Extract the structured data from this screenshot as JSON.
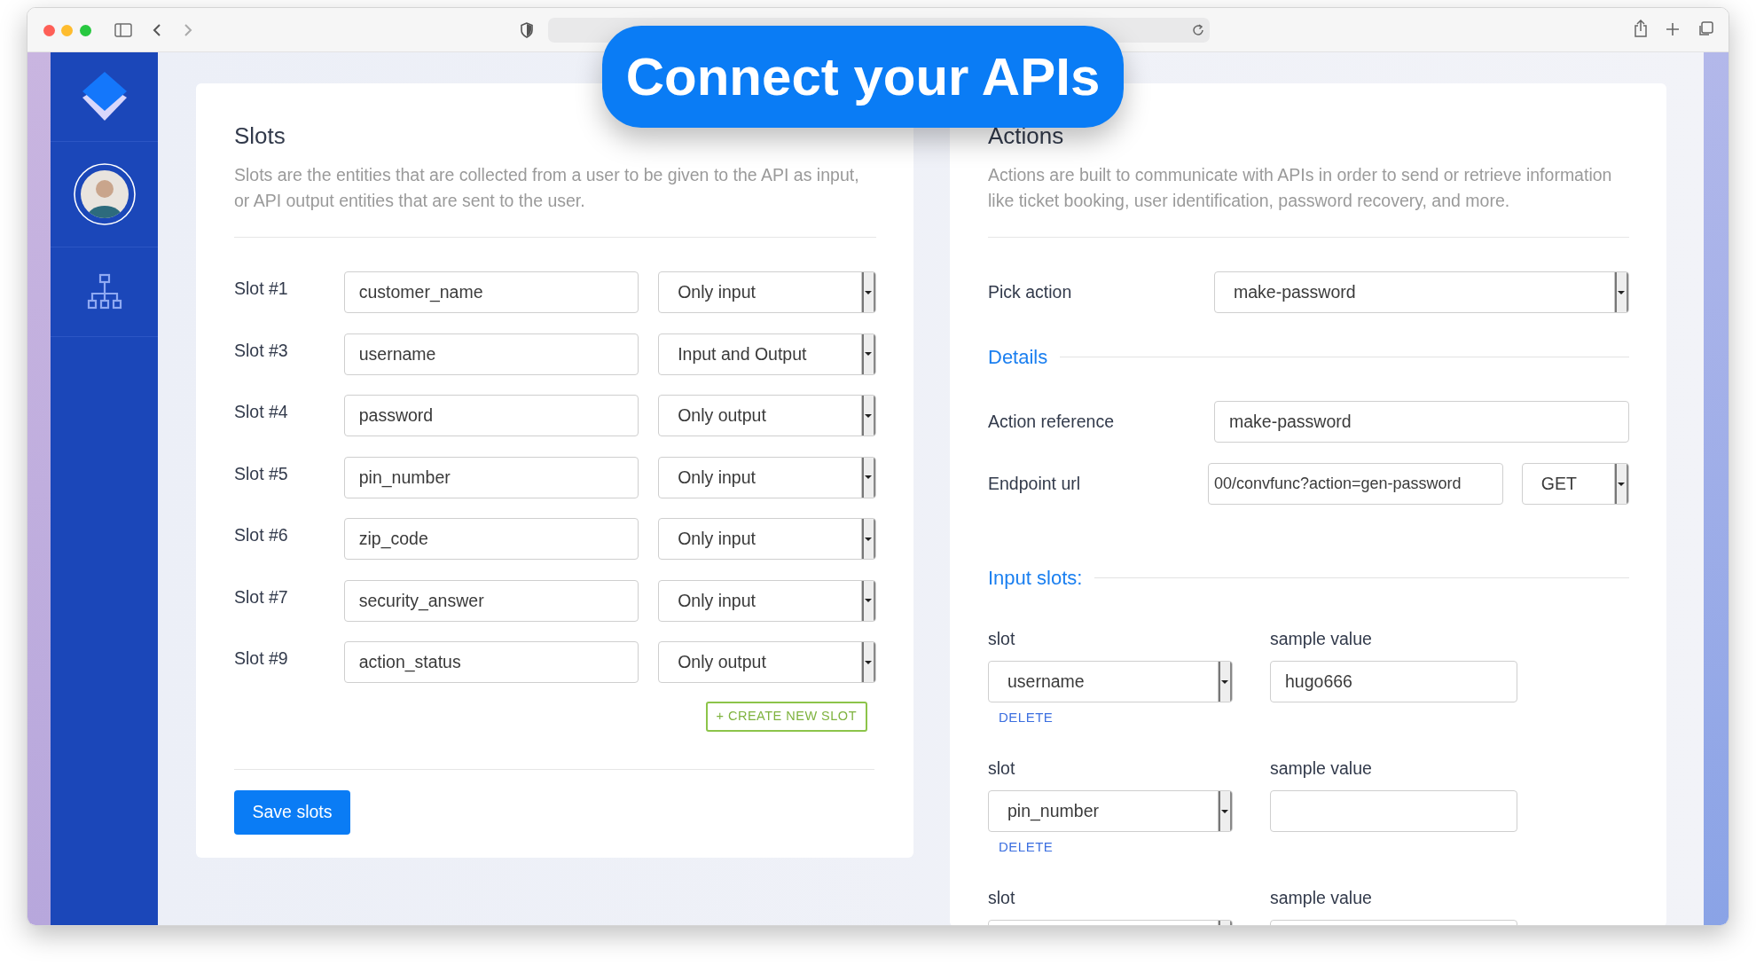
{
  "banner": {
    "text": "Connect your APIs"
  },
  "slots_panel": {
    "title": "Slots",
    "description": "Slots are the entities that are collected from a user to be given to the API as input, or API output entities that are sent to the user.",
    "rows": [
      {
        "label": "Slot #1",
        "value": "customer_name",
        "direction": "Only input"
      },
      {
        "label": "Slot #3",
        "value": "username",
        "direction": "Input and Output"
      },
      {
        "label": "Slot #4",
        "value": "password",
        "direction": "Only output"
      },
      {
        "label": "Slot #5",
        "value": "pin_number",
        "direction": "Only input"
      },
      {
        "label": "Slot #6",
        "value": "zip_code",
        "direction": "Only input"
      },
      {
        "label": "Slot #7",
        "value": "security_answer",
        "direction": "Only input"
      },
      {
        "label": "Slot #9",
        "value": "action_status",
        "direction": "Only output"
      }
    ],
    "create_button": "+ CREATE NEW SLOT",
    "save_button": "Save slots"
  },
  "actions_panel": {
    "title": "Actions",
    "description": "Actions are built to communicate with APIs in order to send or retrieve information like ticket booking, user identification, password recovery, and more.",
    "pick_action": {
      "label": "Pick action",
      "value": "make-password"
    },
    "details": {
      "heading": "Details",
      "action_reference": {
        "label": "Action reference",
        "value": "make-password"
      },
      "endpoint": {
        "label": "Endpoint url",
        "value": "00/convfunc?action=gen-password",
        "method": "GET"
      }
    },
    "input_slots": {
      "heading": "Input slots:",
      "slots": [
        {
          "slot_label": "slot",
          "slot_value": "username",
          "sample_label": "sample value",
          "sample_value": "hugo666",
          "delete": "DELETE"
        },
        {
          "slot_label": "slot",
          "slot_value": "pin_number",
          "sample_label": "sample value",
          "delete": "DELETE"
        },
        {
          "slot_label": "slot",
          "sample_label": "sample value"
        }
      ]
    }
  }
}
